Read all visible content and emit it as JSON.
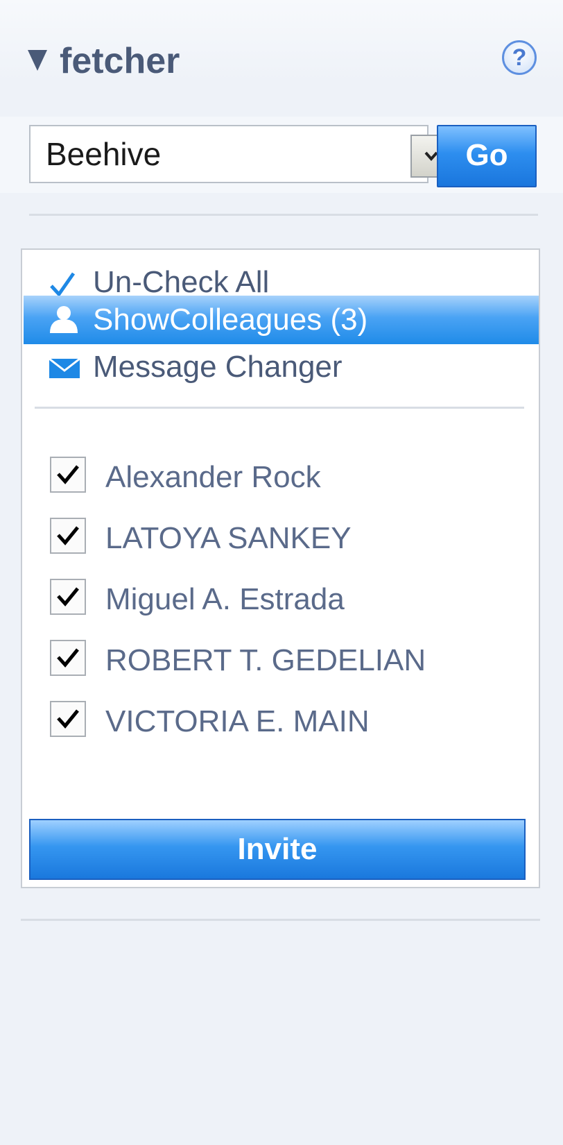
{
  "panel": {
    "title": "fetcher",
    "help_icon_glyph": "?"
  },
  "fetch": {
    "selected_source": "Beehive",
    "go_label": "Go"
  },
  "actions": [
    {
      "label": "Un-Check All",
      "icon": "checkmark-icon",
      "selected": false
    },
    {
      "label": "ShowColleagues (3)",
      "icon": "person-icon",
      "selected": true
    },
    {
      "label": "Message Changer",
      "icon": "envelope-icon",
      "selected": false
    }
  ],
  "members": [
    {
      "name": "Alexander Rock",
      "checked": true
    },
    {
      "name": "LATOYA SANKEY",
      "checked": true
    },
    {
      "name": "Miguel A. Estrada",
      "checked": true
    },
    {
      "name": "ROBERT T. GEDELIAN",
      "checked": true
    },
    {
      "name": "VICTORIA E. MAIN",
      "checked": true
    }
  ],
  "invite_label": "Invite",
  "colors": {
    "accent_blue": "#1f8be8",
    "text_navy": "#4a5a78",
    "panel_bg": "#eef2f8"
  }
}
